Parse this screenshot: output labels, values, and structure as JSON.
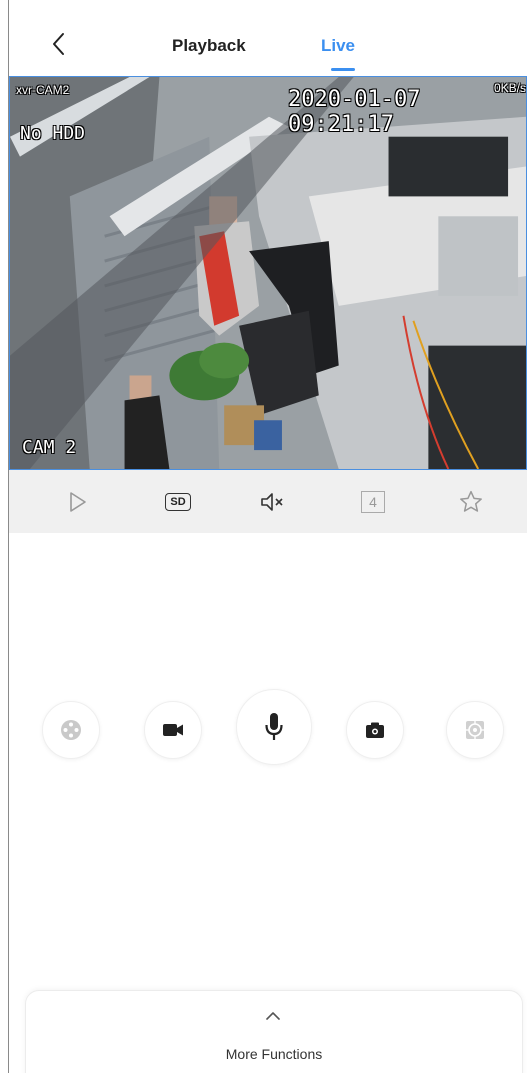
{
  "header": {
    "tabs": [
      {
        "label": "Playback",
        "active": false
      },
      {
        "label": "Live",
        "active": true
      }
    ],
    "accent_color": "#3b8ff0"
  },
  "video": {
    "channel_name": "xvr-CAM2",
    "timestamp": "2020-01-07  09:21:17",
    "bitrate": "0KB/s",
    "overlay_status": "No HDD",
    "camera_label": "CAM 2"
  },
  "toolbar": {
    "play_icon": "play-icon",
    "quality_label": "SD",
    "mute_icon": "speaker-muted-icon",
    "split_label": "4",
    "favorite_icon": "star-icon"
  },
  "controls": [
    {
      "icon": "ptz-icon"
    },
    {
      "icon": "video-record-icon"
    },
    {
      "icon": "microphone-icon"
    },
    {
      "icon": "camera-snapshot-icon"
    },
    {
      "icon": "fisheye-icon"
    }
  ],
  "more": {
    "label": "More Functions"
  }
}
